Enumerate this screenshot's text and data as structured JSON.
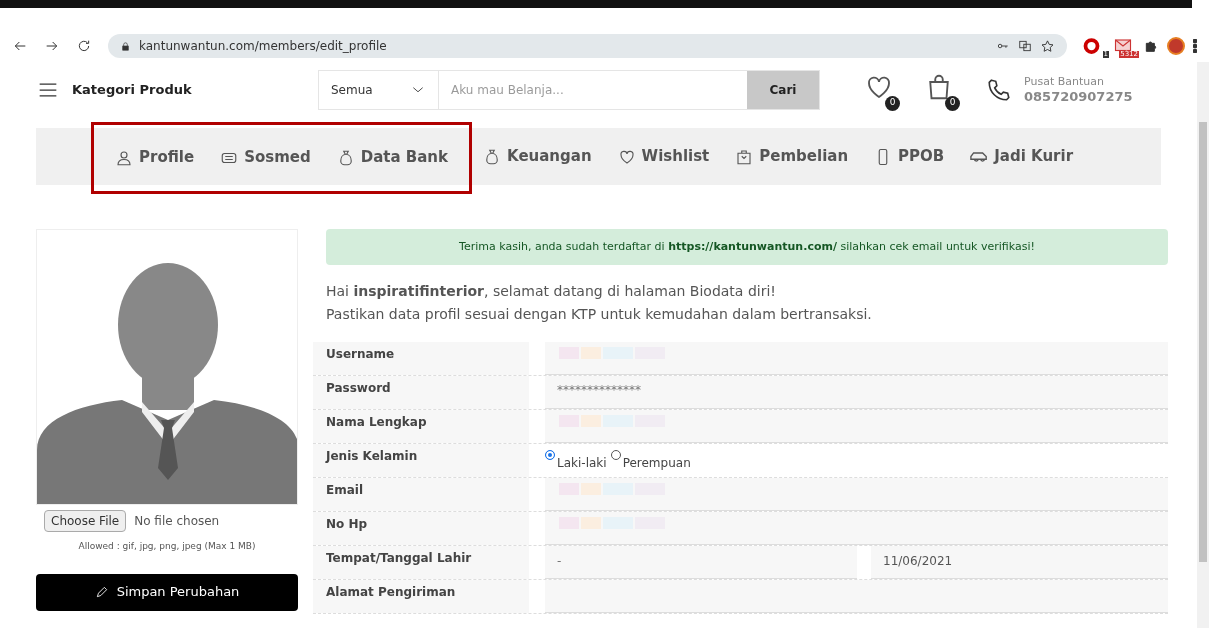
{
  "browser": {
    "url": "kantunwantun.com/members/edit_profile",
    "extension_badges": [
      "1",
      "5312"
    ]
  },
  "header": {
    "category_label": "Kategori Produk",
    "search_scope": "Semua",
    "search_placeholder": "Aku mau Belanja...",
    "search_button": "Cari",
    "wishlist_count": "0",
    "cart_count": "0",
    "help_label": "Pusat Bantuan",
    "help_phone": "085720907275"
  },
  "nav": [
    {
      "label": "Profile",
      "highlighted": true
    },
    {
      "label": "Sosmed",
      "highlighted": true
    },
    {
      "label": "Data Bank",
      "highlighted": true
    },
    {
      "label": "Keuangan",
      "highlighted": false
    },
    {
      "label": "Wishlist",
      "highlighted": false
    },
    {
      "label": "Pembelian",
      "highlighted": false
    },
    {
      "label": "PPOB",
      "highlighted": false
    },
    {
      "label": "Jadi Kurir",
      "highlighted": false
    }
  ],
  "avatar": {
    "choose_file": "Choose File",
    "file_status": "No file chosen",
    "hint": "Allowed : gif, jpg, png, jpeg (Max 1 MB)",
    "save_button": "Simpan Perubahan"
  },
  "alert": "Terima kasih, anda sudah terdaftar di **https://kantunwantun.com/** silahkan cek email untuk verifikasi!",
  "greeting": [
    "Hai **inspiratifinterior**, selamat datang di halaman Biodata diri!",
    "Pastikan data profil sesuai dengan KTP untuk kemudahan dalam bertransaksi."
  ],
  "form": [
    {
      "label": "Username",
      "kind": "blurred"
    },
    {
      "label": "Password",
      "kind": "text",
      "value": "**************"
    },
    {
      "label": "Nama Lengkap",
      "kind": "blurred"
    },
    {
      "label": "Jenis Kelamin",
      "kind": "radio",
      "options": [
        {
          "label": "Laki-laki",
          "selected": true
        },
        {
          "label": "Perempuan",
          "selected": false
        }
      ]
    },
    {
      "label": "Email",
      "kind": "blurred"
    },
    {
      "label": "No Hp",
      "kind": "blurred"
    },
    {
      "label": "Tempat/Tanggal Lahir",
      "kind": "pair",
      "value": "-",
      "value2": "11/06/2021"
    },
    {
      "label": "Alamat Pengiriman",
      "kind": "text"
    }
  ]
}
